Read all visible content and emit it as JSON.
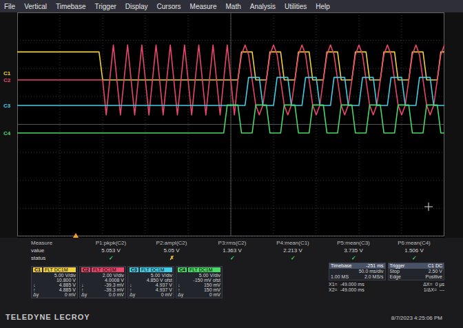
{
  "menu": [
    "File",
    "Vertical",
    "Timebase",
    "Trigger",
    "Display",
    "Cursors",
    "Measure",
    "Math",
    "Analysis",
    "Utilities",
    "Help"
  ],
  "traces": [
    {
      "label": "C1",
      "color": "#f0d040",
      "values": [
        1,
        1,
        1,
        1,
        1,
        1,
        1,
        1,
        1,
        1,
        1,
        1,
        1,
        1,
        1,
        1,
        1,
        1,
        1,
        1,
        1,
        1,
        1,
        1,
        0,
        0,
        0,
        0,
        0,
        0,
        0,
        0,
        0,
        0,
        0,
        0,
        0,
        0,
        0,
        0,
        0,
        0,
        0,
        0,
        0,
        0,
        0,
        0,
        0,
        0,
        0,
        0,
        0,
        0,
        0,
        0,
        0,
        0,
        0,
        0,
        0,
        0,
        0,
        1,
        1,
        1,
        1,
        0,
        0,
        0,
        0,
        1,
        1,
        1,
        1,
        0,
        0,
        0,
        0,
        1,
        1,
        1,
        1,
        0,
        0,
        0,
        0,
        1,
        1,
        1,
        1,
        0,
        0,
        0,
        0,
        1,
        1,
        1,
        1,
        0,
        0,
        0,
        0,
        1,
        1,
        1,
        1,
        0,
        0,
        0,
        0,
        1,
        1,
        1,
        1,
        0,
        0,
        0,
        0,
        1,
        1
      ]
    },
    {
      "label": "C2",
      "color": "#e8466a",
      "values": [
        0,
        0,
        0,
        0,
        0,
        0,
        0,
        0,
        0,
        0,
        0,
        0,
        0,
        0,
        0,
        0,
        0,
        0,
        0,
        0,
        0,
        0,
        0,
        0,
        0,
        -1.25,
        0,
        1.25,
        0,
        -1.25,
        0,
        1.25,
        0,
        -1.25,
        0,
        1.25,
        0,
        -1.25,
        0,
        1.25,
        0,
        -1.25,
        0,
        1.25,
        0,
        -1.25,
        0,
        1.25,
        0,
        -1.25,
        0,
        1.25,
        0,
        -1.25,
        0,
        1.25,
        0,
        -1.25,
        0,
        1.25,
        0,
        -1.25,
        0,
        0.9,
        1.25,
        0.9,
        0,
        -0.9,
        -1.25,
        -0.9,
        0,
        0.9,
        1.25,
        0.9,
        0,
        -0.9,
        -1.25,
        -0.9,
        0,
        0.9,
        1.25,
        0.9,
        0,
        -0.9,
        -1.25,
        -0.9,
        0,
        0.9,
        1.25,
        0.9,
        0,
        -0.9,
        -1.25,
        -0.9,
        0,
        0.9,
        1.25,
        0.9,
        0,
        -0.9,
        -1.25,
        -0.9,
        0,
        0.9,
        1.25,
        0.9,
        0,
        -0.9,
        -1.25,
        -0.9,
        0,
        0.9,
        1.25,
        0.9,
        0,
        -0.9,
        -1.25,
        -0.9,
        0,
        0.9,
        1.25
      ]
    },
    {
      "label": "C3",
      "color": "#46cde6",
      "values": [
        0,
        0,
        0,
        0,
        0,
        0,
        0,
        0,
        0,
        0,
        0,
        0,
        0,
        0,
        0,
        0,
        0,
        0,
        0,
        0,
        0,
        0,
        0,
        0,
        0,
        0,
        0,
        0,
        0,
        0,
        0,
        0,
        0,
        0,
        0,
        0,
        0,
        0,
        0,
        0,
        0,
        0,
        0,
        0,
        0,
        0,
        0,
        0,
        0,
        0,
        0,
        0,
        0,
        0,
        0,
        0,
        0,
        0,
        0,
        0,
        0,
        0,
        0,
        0,
        0,
        1,
        1,
        1,
        1,
        0,
        0,
        0,
        0,
        1,
        1,
        1,
        1,
        0,
        0,
        0,
        0,
        1,
        1,
        1,
        1,
        0,
        0,
        0,
        0,
        1,
        1,
        1,
        1,
        0,
        0,
        0,
        0,
        1,
        1,
        1,
        1,
        0,
        0,
        0,
        0,
        1,
        1,
        1,
        1,
        0,
        0,
        0,
        0,
        1,
        1,
        1,
        1,
        0,
        0,
        0,
        0
      ]
    },
    {
      "label": "C4",
      "color": "#4ad866",
      "values": [
        0,
        0,
        0,
        0,
        0,
        0,
        0,
        0,
        0,
        0,
        0,
        0,
        0,
        0,
        0,
        0,
        0,
        0,
        0,
        0,
        0,
        0,
        0,
        0,
        0,
        0,
        0,
        0,
        0,
        0,
        0,
        0,
        0,
        0,
        0,
        0,
        0,
        0,
        0,
        0,
        0,
        0,
        0,
        0,
        0,
        0,
        0,
        0,
        0,
        0,
        0,
        0,
        0,
        0,
        0,
        0,
        0,
        0,
        0,
        1,
        1,
        1,
        1,
        0,
        0,
        0,
        0,
        1,
        1,
        1,
        1,
        0,
        0,
        0,
        0,
        1,
        1,
        1,
        1,
        0,
        0,
        0,
        0,
        1,
        1,
        1,
        1,
        0,
        0,
        0,
        0,
        1,
        1,
        1,
        1,
        0,
        0,
        0,
        0,
        1,
        1,
        1,
        1,
        0,
        0,
        0,
        0,
        1,
        1,
        1,
        1,
        0,
        0,
        0,
        0,
        1,
        1,
        1,
        1,
        0,
        0
      ]
    }
  ],
  "measure": {
    "header": "Measure",
    "value_label": "value",
    "status_label": "status",
    "params": [
      {
        "name": "P1:pkpk(C2)",
        "value": "5.053 V",
        "status": "✓",
        "ok": true
      },
      {
        "name": "P2:ampl(C2)",
        "value": "5.05 V",
        "status": "✗",
        "ok": false
      },
      {
        "name": "P3:rms(C2)",
        "value": "1.363 V",
        "status": "✓",
        "ok": true
      },
      {
        "name": "P4:mean(C1)",
        "value": "2.213 V",
        "status": "✓",
        "ok": true
      },
      {
        "name": "P5:mean(C3)",
        "value": "3.735 V",
        "status": "✓",
        "ok": true
      },
      {
        "name": "P6:mean(C4)",
        "value": "1.506 V",
        "status": "✓",
        "ok": true
      }
    ]
  },
  "channels": [
    {
      "name": "C1",
      "coupling": "FLT DC1M",
      "color": "#f0d040",
      "scale": "5.00 V/div",
      "offset": "10.800 V",
      "readings": [
        {
          "label": "↓",
          "value": "4.885 V"
        },
        {
          "label": "↑",
          "value": "4.885 V"
        },
        {
          "label": "Δy",
          "value": "0 mV"
        }
      ]
    },
    {
      "name": "C2",
      "coupling": "FLT DC1M",
      "color": "#e8466a",
      "scale": "2.00 V/div",
      "offset": "4.0008 V",
      "readings": [
        {
          "label": "↓",
          "value": "-39.3 mV"
        },
        {
          "label": "↑",
          "value": "-39.3 mV"
        },
        {
          "label": "Δy",
          "value": "0.0 mV"
        }
      ]
    },
    {
      "name": "C3",
      "coupling": "FLT DC1M",
      "color": "#46cde6",
      "scale": "5.00 V/div",
      "offset": "4.850 V ofst",
      "readings": [
        {
          "label": "↓",
          "value": "4.937 V"
        },
        {
          "label": "↑",
          "value": "4.937 V"
        },
        {
          "label": "Δy",
          "value": "0 mV"
        }
      ]
    },
    {
      "name": "C4",
      "coupling": "FLT DC1M",
      "color": "#4ad866",
      "scale": "5.00 V/div",
      "offset": "-150 mV ofst",
      "readings": [
        {
          "label": "↓",
          "value": "150 mV"
        },
        {
          "label": "↑",
          "value": "150 mV"
        },
        {
          "label": "Δy",
          "value": "0 mV"
        }
      ]
    }
  ],
  "timebase": {
    "title": "Timebase",
    "value": "-251 ms",
    "lines": [
      [
        "",
        "50.0 ms/div"
      ],
      [
        "1.00 MS",
        "2.0 MS/s"
      ]
    ]
  },
  "trigger": {
    "title": "Trigger",
    "value": "C1 DC",
    "lines": [
      [
        "Stop",
        "2.50 V"
      ],
      [
        "Edge",
        "Positive"
      ]
    ]
  },
  "cursors": [
    {
      "label": "X1=",
      "value": "-49.000 ms",
      "dlabel": "ΔX=",
      "dvalue": "0 µs"
    },
    {
      "label": "X2=",
      "value": "-49.000 ms",
      "dlabel": "1/ΔX=",
      "dvalue": "---"
    }
  ],
  "brand": "TELEDYNE LECROY",
  "datetime": "8/7/2023 4:25:06 PM"
}
